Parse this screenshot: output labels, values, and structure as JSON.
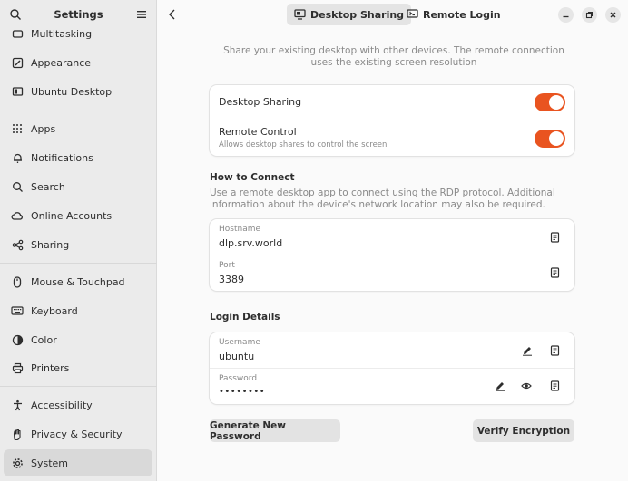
{
  "sidebar": {
    "title": "Settings",
    "items": [
      {
        "label": "Multitasking",
        "icon": "multitasking-icon"
      },
      {
        "label": "Appearance",
        "icon": "appearance-icon"
      },
      {
        "label": "Ubuntu Desktop",
        "icon": "ubuntu-desktop-icon"
      },
      {
        "label": "Apps",
        "icon": "apps-grid-icon"
      },
      {
        "label": "Notifications",
        "icon": "bell-icon"
      },
      {
        "label": "Search",
        "icon": "search-icon"
      },
      {
        "label": "Online Accounts",
        "icon": "cloud-icon"
      },
      {
        "label": "Sharing",
        "icon": "share-icon"
      },
      {
        "label": "Mouse & Touchpad",
        "icon": "mouse-icon"
      },
      {
        "label": "Keyboard",
        "icon": "keyboard-icon"
      },
      {
        "label": "Color",
        "icon": "color-icon"
      },
      {
        "label": "Printers",
        "icon": "printer-icon"
      },
      {
        "label": "Accessibility",
        "icon": "accessibility-icon"
      },
      {
        "label": "Privacy & Security",
        "icon": "privacy-hand-icon"
      },
      {
        "label": "System",
        "icon": "gear-icon"
      }
    ],
    "selected": "System"
  },
  "header": {
    "tabs": [
      {
        "label": "Desktop Sharing",
        "active": true
      },
      {
        "label": "Remote Login",
        "active": false
      }
    ]
  },
  "main": {
    "intro": "Share your existing desktop with other devices. The remote connection uses the existing screen resolution",
    "toggles": {
      "desktop_sharing": {
        "label": "Desktop Sharing",
        "on": true
      },
      "remote_control": {
        "label": "Remote Control",
        "sub": "Allows desktop shares to control the screen",
        "on": true
      }
    },
    "how_to_connect": {
      "title": "How to Connect",
      "desc": "Use a remote desktop app to connect using the RDP protocol. Additional information about the device's network location may also be required.",
      "hostname_label": "Hostname",
      "hostname_value": "dlp.srv.world",
      "port_label": "Port",
      "port_value": "3389"
    },
    "login_details": {
      "title": "Login Details",
      "username_label": "Username",
      "username_value": "ubuntu",
      "password_label": "Password",
      "password_value": "••••••••"
    },
    "buttons": {
      "generate": "Generate New Password",
      "verify": "Verify Encryption"
    }
  },
  "colors": {
    "accent": "#e95420",
    "sidebar_bg": "#ebebeb",
    "selected_bg": "#d9d9d9"
  }
}
